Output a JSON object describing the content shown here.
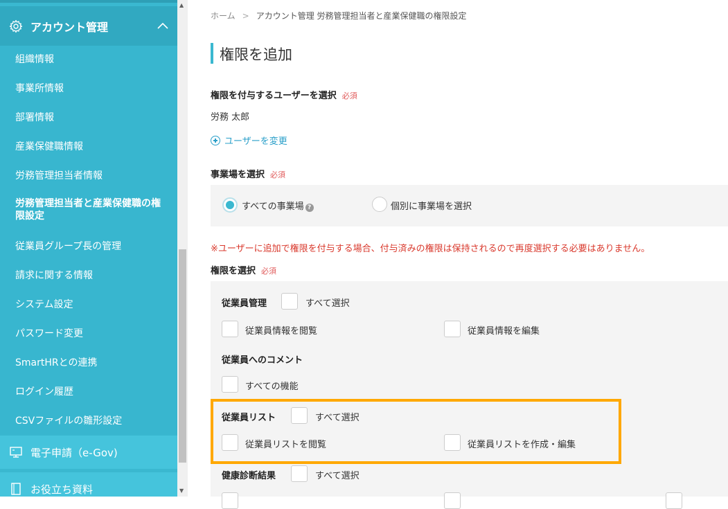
{
  "sidebar": {
    "section_title": "アカウント管理",
    "items": [
      {
        "label": "組織情報"
      },
      {
        "label": "事業所情報"
      },
      {
        "label": "部署情報"
      },
      {
        "label": "産業保健職情報"
      },
      {
        "label": "労務管理担当者情報"
      },
      {
        "label": "労務管理担当者と産業保健職の権限設定"
      },
      {
        "label": "従業員グループ長の管理"
      },
      {
        "label": "請求に関する情報"
      },
      {
        "label": "システム設定"
      },
      {
        "label": "パスワード変更"
      },
      {
        "label": "SmartHRとの連携"
      },
      {
        "label": "ログイン履歴"
      },
      {
        "label": "CSVファイルの雛形設定"
      }
    ],
    "bottom": [
      {
        "label": "電子申請（e-Gov)",
        "icon": "monitor-icon"
      },
      {
        "label": "お役立ち資料",
        "icon": "book-icon"
      }
    ],
    "accent_color": "#3ab8d0"
  },
  "breadcrumb": {
    "home": "ホーム",
    "separator": ">",
    "path": "アカウント管理 労務管理担当者と産業保健職の権限設定"
  },
  "page": {
    "title": "権限を追加"
  },
  "user_section": {
    "label": "権限を付与するユーザーを選択",
    "required": "必須",
    "selected_user": "労務 太郎",
    "change_link": "ユーザーを変更"
  },
  "workplace_section": {
    "label": "事業場を選択",
    "required": "必須",
    "options": [
      {
        "label": "すべての事業場",
        "selected": true
      },
      {
        "label": "個別に事業場を選択",
        "selected": false
      }
    ],
    "help_icon": "?"
  },
  "notice": "※ユーザーに追加で権限を付与する場合、付与済みの権限は保持されるので再度選択する必要はありません。",
  "permission_section": {
    "label": "権限を選択",
    "required": "必須",
    "groups": [
      {
        "title": "従業員管理",
        "select_all": "すべて選択",
        "items": [
          "従業員情報を閲覧",
          "従業員情報を編集"
        ]
      },
      {
        "title": "従業員へのコメント",
        "items": [
          "すべての機能"
        ]
      },
      {
        "title": "従業員リスト",
        "select_all": "すべて選択",
        "items": [
          "従業員リストを閲覧",
          "従業員リストを作成・編集"
        ]
      },
      {
        "title": "健康診断結果",
        "select_all": "すべて選択",
        "items": []
      }
    ]
  },
  "highlight_color": "#ffa800"
}
